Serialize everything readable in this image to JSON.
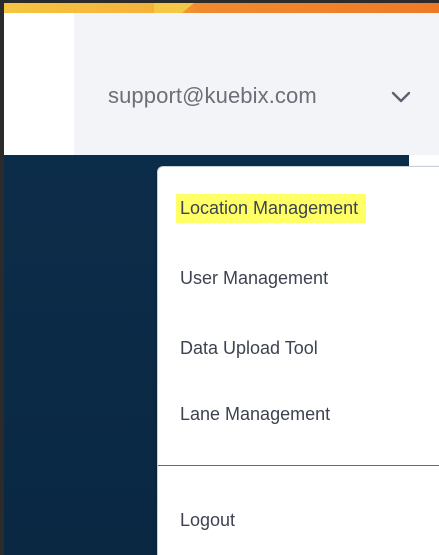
{
  "header": {
    "user_email": "support@kuebix.com",
    "chevron_icon": "chevron-down-icon"
  },
  "menu": {
    "items": [
      {
        "label": "Location Management",
        "highlighted": true
      },
      {
        "label": "User Management"
      },
      {
        "label": "Data Upload Tool"
      },
      {
        "label": "Lane Management"
      }
    ],
    "logout_label": "Logout"
  },
  "colors": {
    "accent_orange": "#ee7a28",
    "accent_yellow": "#f5c542",
    "dark_navy": "#0b2a46",
    "highlight": "#ffff66"
  }
}
